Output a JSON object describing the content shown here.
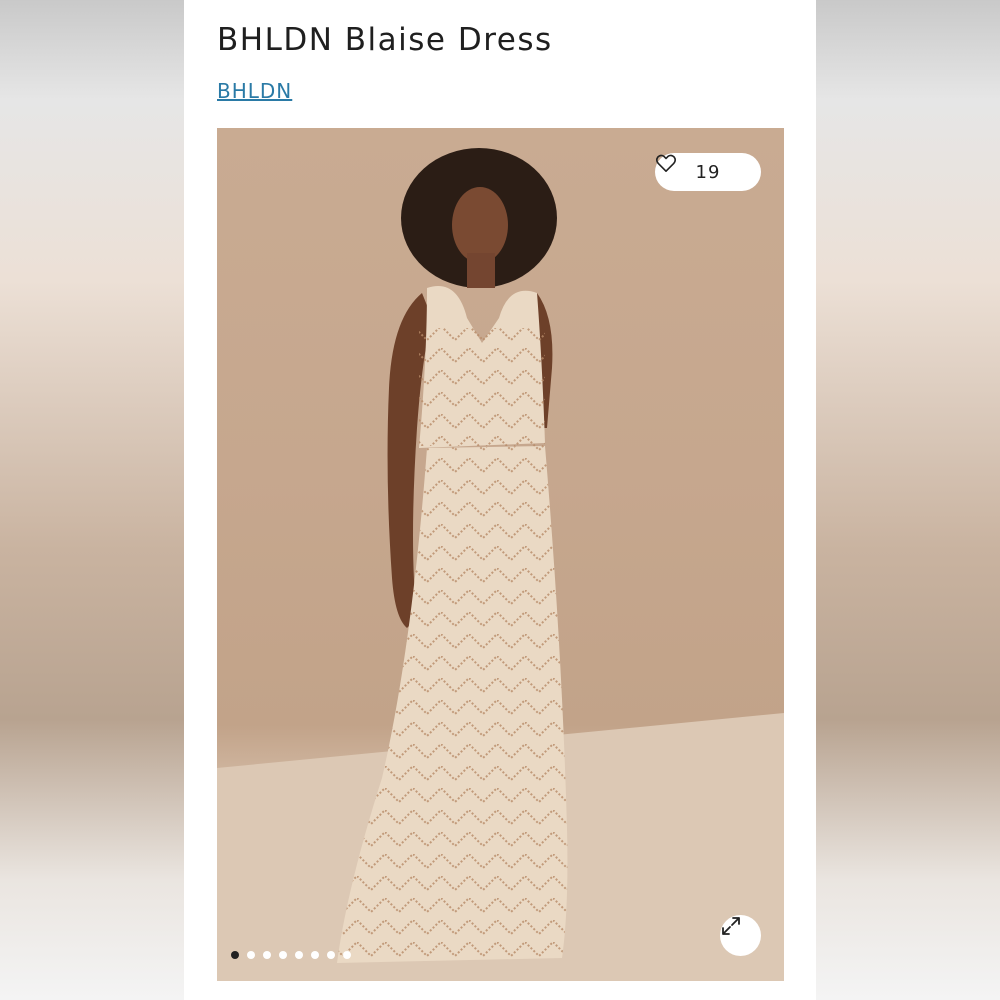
{
  "product": {
    "title": "BHLDN Blaise Dress",
    "brand": "BHLDN"
  },
  "gallery": {
    "likes_count": "19",
    "like_icon": "heart-icon",
    "expand_icon": "expand-icon",
    "image_count": 8,
    "active_index": 0
  },
  "colors": {
    "brand_link": "#2a7aa6",
    "title_text": "#1f1f1f",
    "photo_background": "#c6a78e",
    "dress": "#ead9c4"
  }
}
